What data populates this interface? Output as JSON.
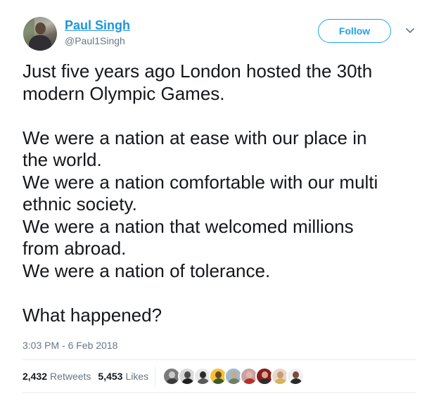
{
  "author": {
    "name": "Paul Singh",
    "handle": "@Paul1Singh",
    "avatar_icon": "avatar-photo"
  },
  "follow_button": {
    "label": "Follow",
    "color": "#1da1f2"
  },
  "menu": {
    "icon": "chevron-down-icon"
  },
  "tweet": {
    "lines": [
      "Just five years ago London hosted the 30th",
      "modern Olympic Games.",
      "",
      "We were a nation at ease with our place in",
      "the world.",
      "We were a nation comfortable with our multi",
      "ethnic society.",
      "We were a nation that welcomed millions",
      "from abroad.",
      "We were a nation of tolerance.",
      "",
      "What happened?"
    ],
    "timestamp": "3:03 PM - 6 Feb 2018"
  },
  "stats": {
    "retweets_count": "2,432",
    "retweets_label": "Retweets",
    "likes_count": "5,453",
    "likes_label": "Likes"
  },
  "likers": [
    {
      "bg": "#7b7b7b",
      "face": "#c9c9c9",
      "body": "#3a3a3a"
    },
    {
      "bg": "#d8d8d8",
      "face": "#4a4a4a",
      "body": "#1f1f1f"
    },
    {
      "bg": "#e9e9e9",
      "face": "#2b2b2b",
      "body": "#5a5a5a"
    },
    {
      "bg": "#f3c23c",
      "face": "#6b4a1a",
      "body": "#3b5a2a"
    },
    {
      "bg": "#9fb8cf",
      "face": "#c8a98a",
      "body": "#6f7f5f"
    },
    {
      "bg": "#c9a3a3",
      "face": "#e0b8a8",
      "body": "#b5302a"
    },
    {
      "bg": "#8a1c1c",
      "face": "#d7a890",
      "body": "#2c2c2c"
    },
    {
      "bg": "#e8d8c8",
      "face": "#c99a78",
      "body": "#d7b25a"
    },
    {
      "bg": "#f0f0f0",
      "face": "#7a4a3a",
      "body": "#2a2a2a"
    }
  ]
}
